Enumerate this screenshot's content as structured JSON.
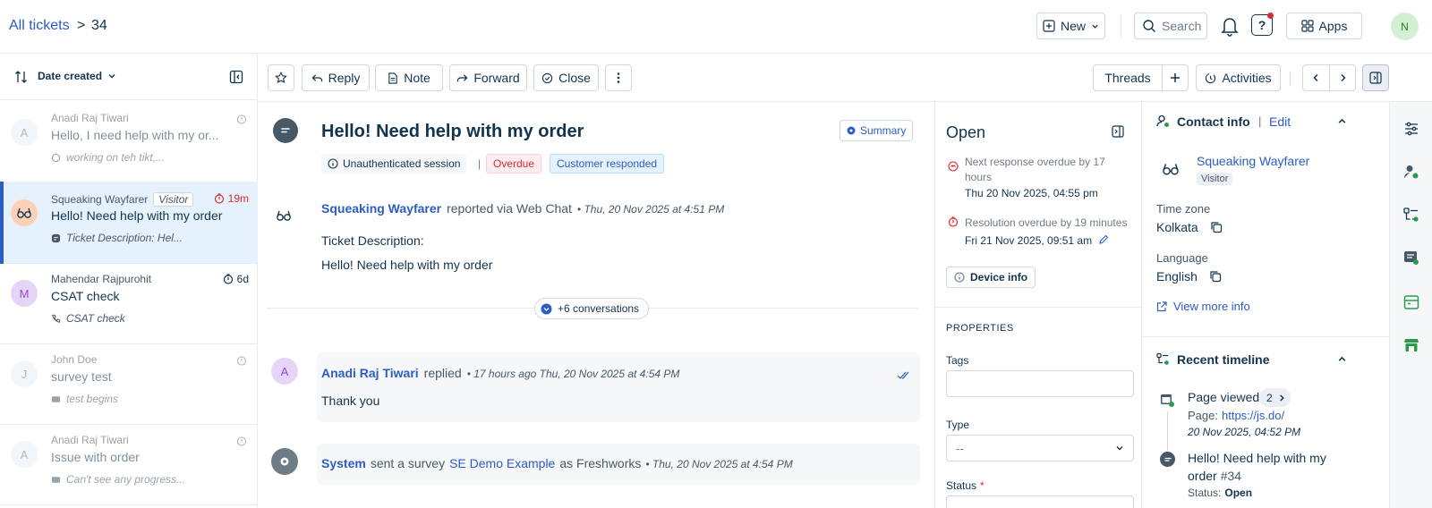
{
  "header": {
    "breadcrumb_root": "All tickets",
    "breadcrumb_sep": ">",
    "ticket_id": "34",
    "new_label": "New",
    "search_placeholder": "Search",
    "apps_label": "Apps",
    "avatar_initial": "N"
  },
  "list": {
    "sort_label": "Date created",
    "items": [
      {
        "name": "Anadi Raj Tiwari",
        "subject": "Hello, I need help with my or...",
        "preview": "working on teh tikt,...",
        "avatar": "A",
        "time": "",
        "visitor": ""
      },
      {
        "name": "Squeaking Wayfarer",
        "subject": "Hello! Need help with my order",
        "preview": "Ticket Description: Hel...",
        "avatar": "",
        "time": "19m",
        "visitor": "Visitor"
      },
      {
        "name": "Mahendar Rajpurohit",
        "subject": "CSAT check",
        "preview": "CSAT check",
        "avatar": "M",
        "time": "6d",
        "visitor": ""
      },
      {
        "name": "John Doe",
        "subject": "survey test",
        "preview": "test begins",
        "avatar": "J",
        "time": "",
        "visitor": ""
      },
      {
        "name": "Anadi Raj Tiwari",
        "subject": "Issue with order",
        "preview": "Can't see any progress...",
        "avatar": "A",
        "time": "",
        "visitor": ""
      }
    ]
  },
  "toolbar": {
    "reply": "Reply",
    "note": "Note",
    "forward": "Forward",
    "close": "Close",
    "threads": "Threads",
    "activities": "Activities"
  },
  "ticket": {
    "title": "Hello! Need help with my order",
    "summary": "Summary",
    "tag_session": "Unauthenticated session",
    "tag_sep": "|",
    "tag_overdue": "Overdue",
    "tag_responded": "Customer responded",
    "reporter": "Squeaking Wayfarer",
    "reported_via": "reported via Web Chat",
    "reported_time": "• Thu, 20 Nov 2025 at 4:51 PM",
    "desc_label": "Ticket Description:",
    "desc_text": "Hello! Need help with my order",
    "conversations": "+6 conversations",
    "reply_author": "Anadi Raj Tiwari",
    "reply_verb": "replied",
    "reply_time": "• 17 hours ago Thu, 20 Nov 2025 at 4:54 PM",
    "reply_avatar": "A",
    "reply_text": "Thank you",
    "system_author": "System",
    "system_verb": "sent a survey",
    "system_survey": "SE Demo Example",
    "system_as": "as Freshworks",
    "system_time": "• Thu, 20 Nov 2025 at 4:54 PM"
  },
  "props": {
    "status": "Open",
    "next_response": "Next response overdue by 17 hours",
    "next_response_time": "Thu 20 Nov 2025, 04:55 pm",
    "resolution": "Resolution overdue by 19 minutes",
    "resolution_time": "Fri 21 Nov 2025, 09:51 am",
    "device_info": "Device info",
    "properties_heading": "PROPERTIES",
    "tags_label": "Tags",
    "type_label": "Type",
    "type_value": "--",
    "status_label": "Status",
    "required_mark": "*"
  },
  "contact": {
    "heading": "Contact info",
    "sep": "|",
    "edit": "Edit",
    "name": "Squeaking Wayfarer",
    "badge": "Visitor",
    "tz_label": "Time zone",
    "tz_value": "Kolkata",
    "lang_label": "Language",
    "lang_value": "English",
    "more_info": "View more info",
    "timeline_heading": "Recent timeline",
    "tl_page_viewed": "Page viewed",
    "tl_page_count": "2",
    "tl_page_prefix": "Page:",
    "tl_page_url": "https://js.do/",
    "tl_page_time": "20 Nov 2025, 04:52 PM",
    "tl_ticket_title_1": "Hello! Need help with my",
    "tl_ticket_title_2": "order",
    "tl_ticket_id": "#34",
    "tl_status_label": "Status:",
    "tl_status_value": "Open"
  },
  "colors": {
    "link": "#2c5cc5",
    "selected_bg": "#e5f2fd",
    "selected_bar": "#2c5cc5",
    "overdue_red": "#d72d30"
  }
}
